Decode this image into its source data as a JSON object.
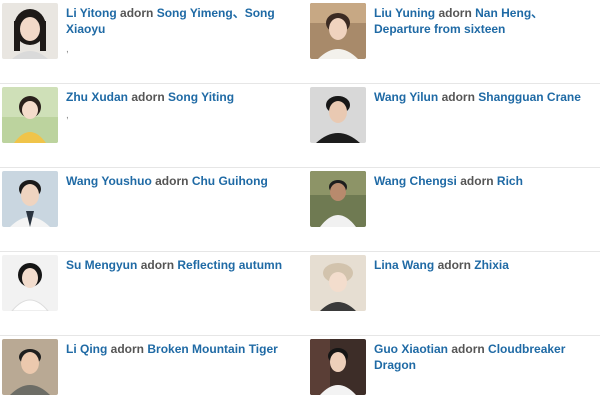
{
  "verb": "adorn",
  "rows": [
    {
      "left": {
        "actor": "Li Yitong",
        "role": "Song Yimeng、Song Xiaoyu",
        "mark": ","
      },
      "right": {
        "actor": "Liu Yuning",
        "role": "Nan Heng、Departure from sixteen"
      }
    },
    {
      "left": {
        "actor": "Zhu Xudan",
        "role": "Song Yiting",
        "mark": ","
      },
      "right": {
        "actor": "Wang Yilun",
        "role": "Shangguan Crane"
      }
    },
    {
      "left": {
        "actor": "Wang Youshuo",
        "role": "Chu Guihong"
      },
      "right": {
        "actor": "Wang Chengsi",
        "role": "Rich"
      }
    },
    {
      "left": {
        "actor": "Su Mengyun",
        "role": "Reflecting autumn"
      },
      "right": {
        "actor": "Lina Wang",
        "role": "Zhixia"
      }
    },
    {
      "left": {
        "actor": "Li Qing",
        "role": "Broken Mountain Tiger"
      },
      "right": {
        "actor": "Guo Xiaotian",
        "role": "Cloudbreaker Dragon"
      }
    }
  ],
  "colors": {
    "link": "#1f6aa5",
    "text": "#555555",
    "divider": "#e6e6e6"
  }
}
